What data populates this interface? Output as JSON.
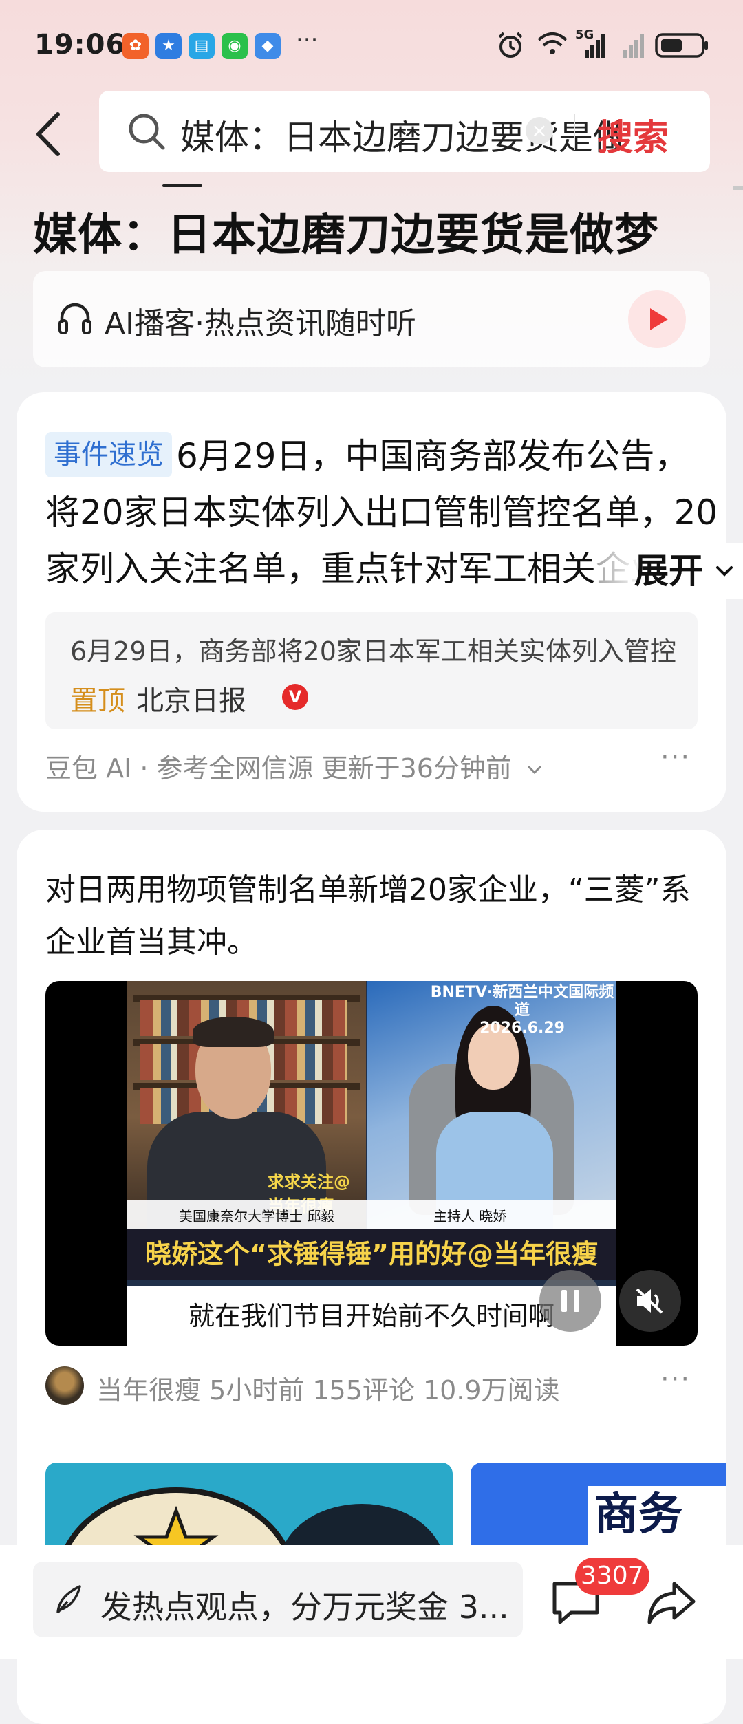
{
  "status_bar": {
    "time": "19:06",
    "more": "···",
    "network": "5G"
  },
  "search": {
    "query": "媒体：日本边磨刀边要货是做梦",
    "button": "搜索",
    "clear": "×"
  },
  "headline": "媒体：日本边磨刀边要货是做梦",
  "podcast": {
    "label": "AI播客·热点资讯随时听"
  },
  "event_card": {
    "tag": "事件速览",
    "summary": "6月29日，中国商务部发布公告，将20家日本实体列入出口管制管控名单，20家列入关注名单，重点针对军工相关企业。",
    "expand": "展开",
    "source_text": "6月29日，商务部将20家日本军工相关实体列入管控名单",
    "pinned": "置顶",
    "source_name": "北京日报",
    "verified": "V",
    "footer": "豆包 AI · 参考全网信源 更新于36分钟前",
    "more": "···"
  },
  "article": {
    "title": "对日两用物项管制名单新增20家企业，“三菱”系企业首当其冲。",
    "video": {
      "channel_line1": "BNETV·新西兰中文国际频道",
      "channel_line2": "2026.6.29",
      "watermark": "求求关注@当年很瘦",
      "caption_left": "美国康奈尔大学博士 邱毅",
      "caption_right": "主持人 晓娇",
      "subtitle_yellow": "晓娇这个“求锤得锤”用的好@当年很瘦",
      "subtitle_white": "就在我们节目开始前不久时间啊"
    },
    "author": "当年很瘦",
    "meta": "当年很瘦  5小时前  155评论  10.9万阅读",
    "more": "···"
  },
  "thumb2_text": "商务部",
  "bottom_bar": {
    "comment_placeholder": "发热点观点，分万元奖金 3...",
    "comment_count": "3307"
  },
  "colors": {
    "accent_red": "#e4393c",
    "tag_blue": "#2f6fd0",
    "pinned_orange": "#d58e1c",
    "badge_red": "#ef3b3b"
  }
}
